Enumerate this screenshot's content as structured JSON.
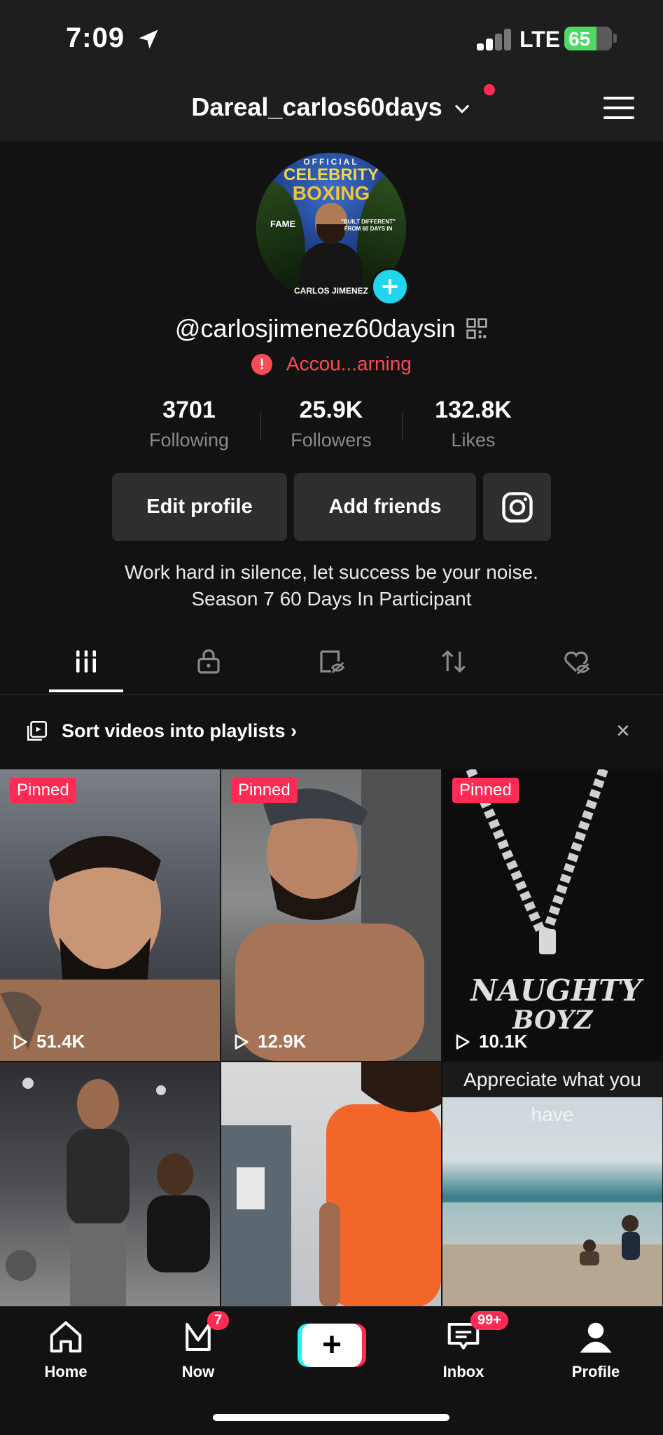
{
  "status_bar": {
    "time": "7:09",
    "network": "LTE",
    "battery": "65"
  },
  "header": {
    "username": "Dareal_carlos60days"
  },
  "profile": {
    "avatar_text": {
      "official": "OFFICIAL",
      "celebrity": "CELEBRITY",
      "boxing": "BOXING",
      "fame": "FAME",
      "built": "\"BUILT DIFFERENT\" FROM 60 DAYS IN",
      "name": "CARLOS JIMENEZ"
    },
    "handle": "@carlosjimenez60daysin",
    "warning": "Accou...arning"
  },
  "stats": [
    {
      "value": "3701",
      "label": "Following"
    },
    {
      "value": "25.9K",
      "label": "Followers"
    },
    {
      "value": "132.8K",
      "label": "Likes"
    }
  ],
  "buttons": {
    "edit_profile": "Edit profile",
    "add_friends": "Add friends"
  },
  "bio": {
    "line1": "Work hard in silence, let success be your noise.",
    "line2": "Season 7 60 Days In Participant"
  },
  "playlist_bar": {
    "label": "Sort videos into playlists",
    "close": "×"
  },
  "videos": [
    {
      "pinned": "Pinned",
      "views": "51.4K"
    },
    {
      "pinned": "Pinned",
      "views": "12.9K"
    },
    {
      "pinned": "Pinned",
      "views": "10.1K"
    },
    {
      "views": ""
    },
    {
      "views": ""
    },
    {
      "caption": "Appreciate what you have"
    }
  ],
  "nav": {
    "home": "Home",
    "now": "Now",
    "now_badge": "7",
    "create": "+",
    "inbox": "Inbox",
    "inbox_badge": "99+",
    "profile": "Profile"
  },
  "colors": {
    "accent": "#fe2c55",
    "warning": "#fe4a55",
    "teal": "#20d5ec"
  }
}
